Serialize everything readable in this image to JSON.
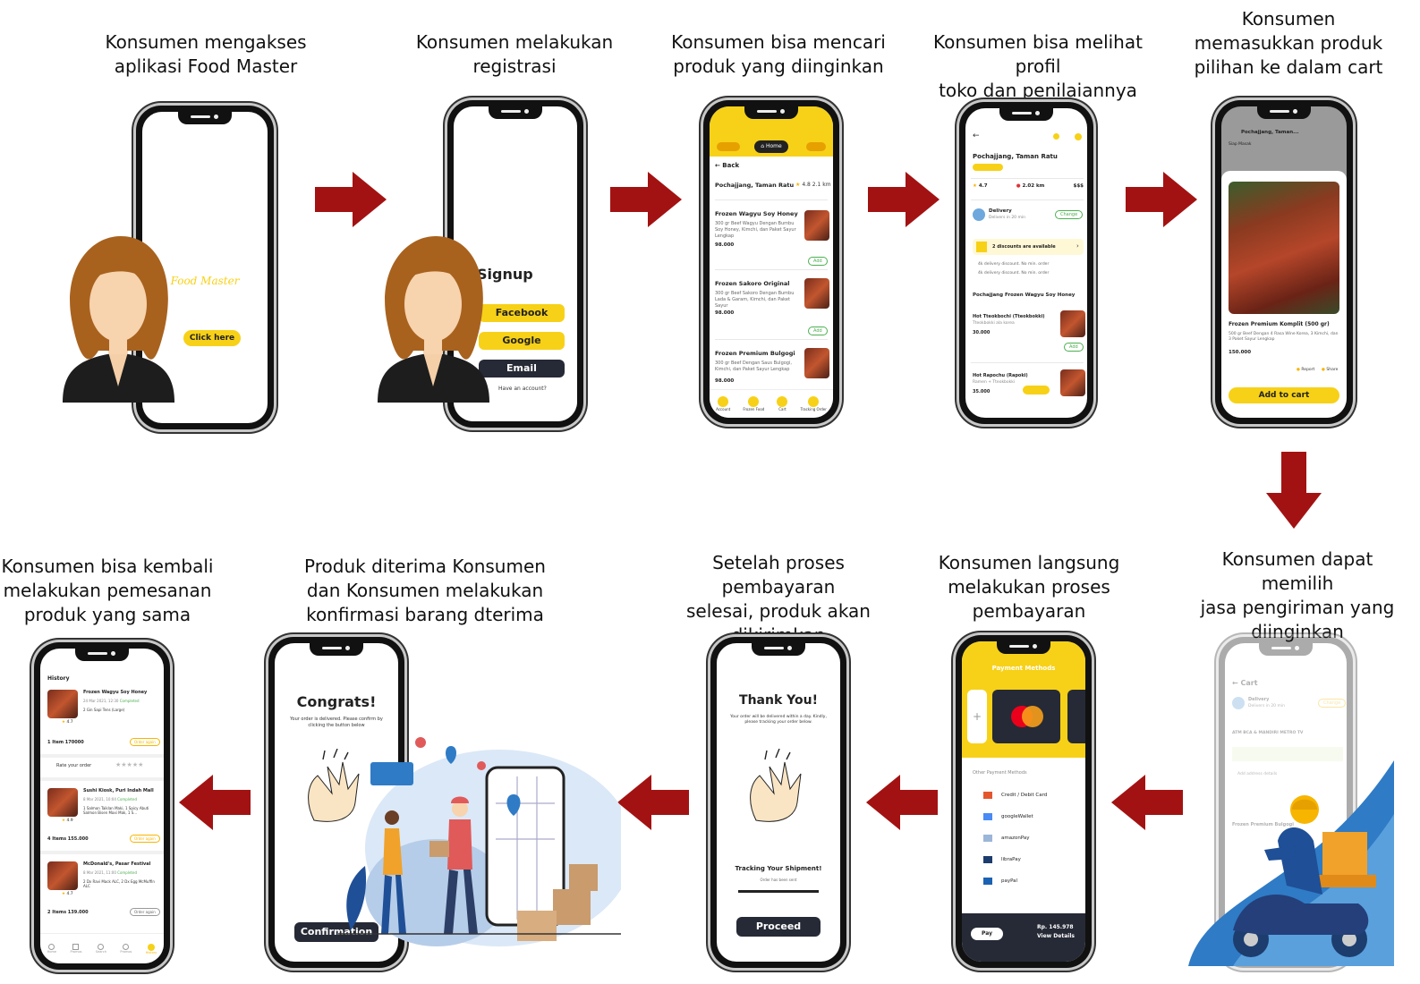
{
  "steps": {
    "s1": "Konsumen mengakses\naplikasi Food Master",
    "s2": "Konsumen melakukan\nregistrasi",
    "s3": "Konsumen bisa mencari\nproduk yang diinginkan",
    "s4": "Konsumen bisa melihat profil\ntoko dan penilaiannya",
    "s5": "Konsumen\nmemasukkan produk\npilihan ke dalam cart",
    "s6": "Konsumen dapat memilih\njasa pengiriman yang\ndiinginkan",
    "s7": "Konsumen langsung\nmelakukan proses\npembayaran",
    "s8": "Setelah proses pembayaran\nselesai, produk akan\ndikirimkan",
    "s9": "Produk diterima Konsumen\ndan Konsumen melakukan\nkonfirmasi barang dterima",
    "s10": "Konsumen bisa kembali\nmelakukan pemesanan\nproduk yang sama"
  },
  "splash": {
    "logo_text": "Food Master",
    "cta": "Click here"
  },
  "signup": {
    "title": "Signup",
    "facebook": "Facebook",
    "google": "Google",
    "email": "Email",
    "footer": "Have an account?"
  },
  "search": {
    "home_tab": "Home",
    "back": "← Back",
    "store": "Pochajjang, Taman Ratu",
    "rating": "4.8",
    "distance": "2.1 km",
    "items": [
      {
        "name": "Frozen Wagyu Soy Honey",
        "desc": "300 gr Beef Wagyu Dengan Bumbu Soy Honey, Kimchi, dan Paket Sayur Lengkap",
        "price": "98.000",
        "add": "Add"
      },
      {
        "name": "Frozen Sakoro Original",
        "desc": "300 gr Beef Sakoro Dengan Bumbu Lada & Garam, Kimchi, dan Paket Sayur",
        "price": "98.000",
        "add": "Add"
      },
      {
        "name": "Frozen Premium Bulgogi",
        "desc": "300 gr Beef Dengan Saus Bulgogi, Kimchi, dan Paket Sayur Lengkap",
        "price": "98.000",
        "add": "Add"
      }
    ],
    "nav": [
      "Account",
      "Frozen Food",
      "Cart",
      "Tracking Order"
    ]
  },
  "profile": {
    "store": "Pochajjang, Taman Ratu",
    "rating": "4.7",
    "distance": "2.02 km",
    "price_range": "$$$",
    "delivery": "Delivery",
    "delivery_sub": "Delivers in 20 min",
    "change": "Change",
    "discounts": "2 discounts are available",
    "disc1": "4k delivery discount. No min. order",
    "disc2": "4k delivery discount. No min. order",
    "section": "Pochajjang Frozen Wagyu Soy Honey",
    "item1": "Hot Tteokbochi (Tteokbokki)",
    "item1_sub": "Tteokbokki ala korea",
    "item1_price": "30.000",
    "item2": "Hot Rapochu (Rapoki)",
    "item2_sub": "Ramen + Tteokbokki",
    "item2_price": "35.000",
    "add": "Add"
  },
  "cart_detail": {
    "header": "Pochajjang, Taman...",
    "sub": "Siap Masak",
    "product": "Frozen Premium Komplit (500 gr)",
    "desc": "500 gr Beef Dengan 4 Rasa Wine Korea, 3 Kimchi, dan 3 Paket Sayur Lengkap",
    "price": "150.000",
    "report": "Report",
    "share": "Share",
    "add_to_cart": "Add to cart"
  },
  "shipping": {
    "title": "← Cart",
    "delivery": "Delivery",
    "delivery_sub": "Delivers in 20 min",
    "change": "Change",
    "address": "ATM BCA & MANDIRI METRO TV",
    "note": "Add address details",
    "item": "Frozen Premium Bulgogi"
  },
  "payment": {
    "header": "Payment Methods",
    "other": "Other Payment Methods",
    "methods": [
      "Credit / Debit Card",
      "googleWallet",
      "amazonPay",
      "libraPay",
      "payPal"
    ],
    "pay": "Pay",
    "total": "Rp. 145.978",
    "view": "View Details"
  },
  "thanks": {
    "title": "Thank You!",
    "body": "Your order will be delivered within a day. Kindly, please tracking your order below.",
    "tracking": "Tracking Your Shipment!",
    "tracking_sub": "Order has been sent",
    "proceed": "Proceed"
  },
  "congrats": {
    "title": "Congrats!",
    "body": "Your order is delivered. Please confirm by clicking the button below",
    "confirm": "Confirmation"
  },
  "history": {
    "title": "History",
    "orders": [
      {
        "name": "Frozen Wagyu Soy Honey",
        "date": "24 Mar 2021, 12:30",
        "status": "Completed",
        "detail": "2 Gin Sapi Tens (Large)",
        "summary": "1 Item   170000",
        "rating": "4.7"
      },
      {
        "name": "Sushi Kiosk, Puri Indah Mall",
        "date": "8 Mar 2021, 10:04",
        "status": "Completed",
        "detail": "1 Salmon Taiklan Maki, 1 Spicy Abuti Salmon Bisen Maxi Mak, 1 S...",
        "summary": "4 Items   155.000",
        "rating": "4.9"
      },
      {
        "name": "McDonald's, Pasar Festival",
        "date": "8 Mar 2021, 11:00",
        "status": "Completed",
        "detail": "2 Dx Ravi Mack ALC, 2 Dx Egg McMuffin ALC",
        "summary": "2 Items   139.000",
        "rating": "4.7"
      }
    ],
    "rate": "Rate your order",
    "order_again": "Order again",
    "nav": [
      "Home",
      "Promos",
      "Search",
      "Promos",
      "History"
    ]
  },
  "colors": {
    "yellow": "#f7d117",
    "dark": "#262a36",
    "arrow": "#a31212"
  }
}
